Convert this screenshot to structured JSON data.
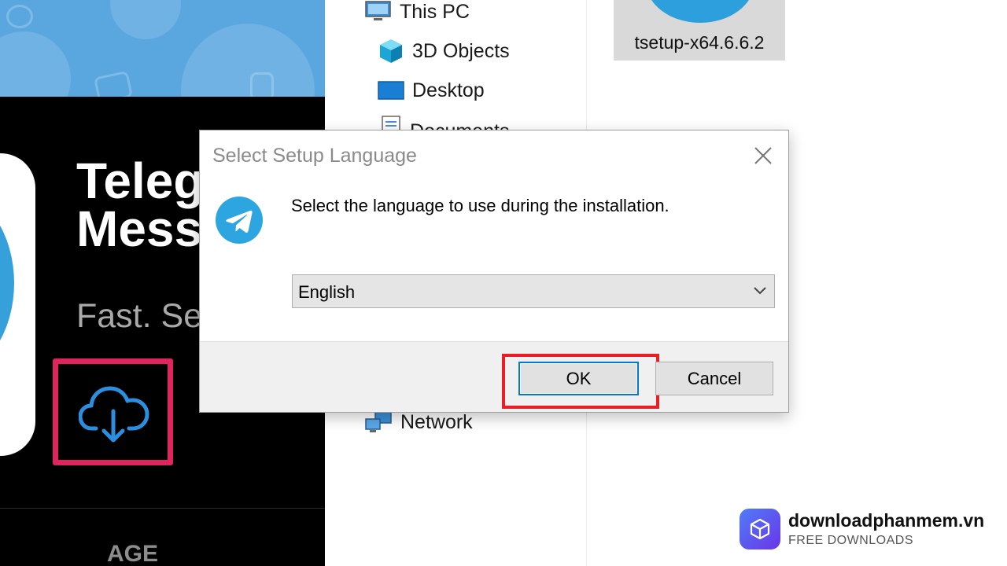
{
  "store": {
    "app_title": "Teleg\nMess",
    "app_subtitle": "Fast. Se",
    "age_label": "AGE",
    "download_icon": "cloud-download-icon",
    "highlight_color": "#e0245e"
  },
  "explorer": {
    "nav_items": [
      {
        "label": "This PC",
        "icon": "computer-icon"
      },
      {
        "label": "3D Objects",
        "icon": "cube-icon"
      },
      {
        "label": "Desktop",
        "icon": "desktop-icon"
      },
      {
        "label": "Documents",
        "icon": "document-icon"
      },
      {
        "label": "Network",
        "icon": "network-icon"
      }
    ],
    "file": {
      "name": "tsetup-x64.6.6.2",
      "icon": "telegram-setup-icon"
    }
  },
  "dialog": {
    "title": "Select Setup Language",
    "message": "Select the language to use during the installation.",
    "language_select": {
      "value": "English"
    },
    "ok_label": "OK",
    "cancel_label": "Cancel",
    "ok_highlight_color": "#ea1c24",
    "logo_icon": "telegram-logo-icon",
    "close_icon": "close-icon"
  },
  "watermark": {
    "name": "downloadphanmem.vn",
    "tagline": "FREE DOWNLOADS",
    "icon": "package-box-icon"
  }
}
